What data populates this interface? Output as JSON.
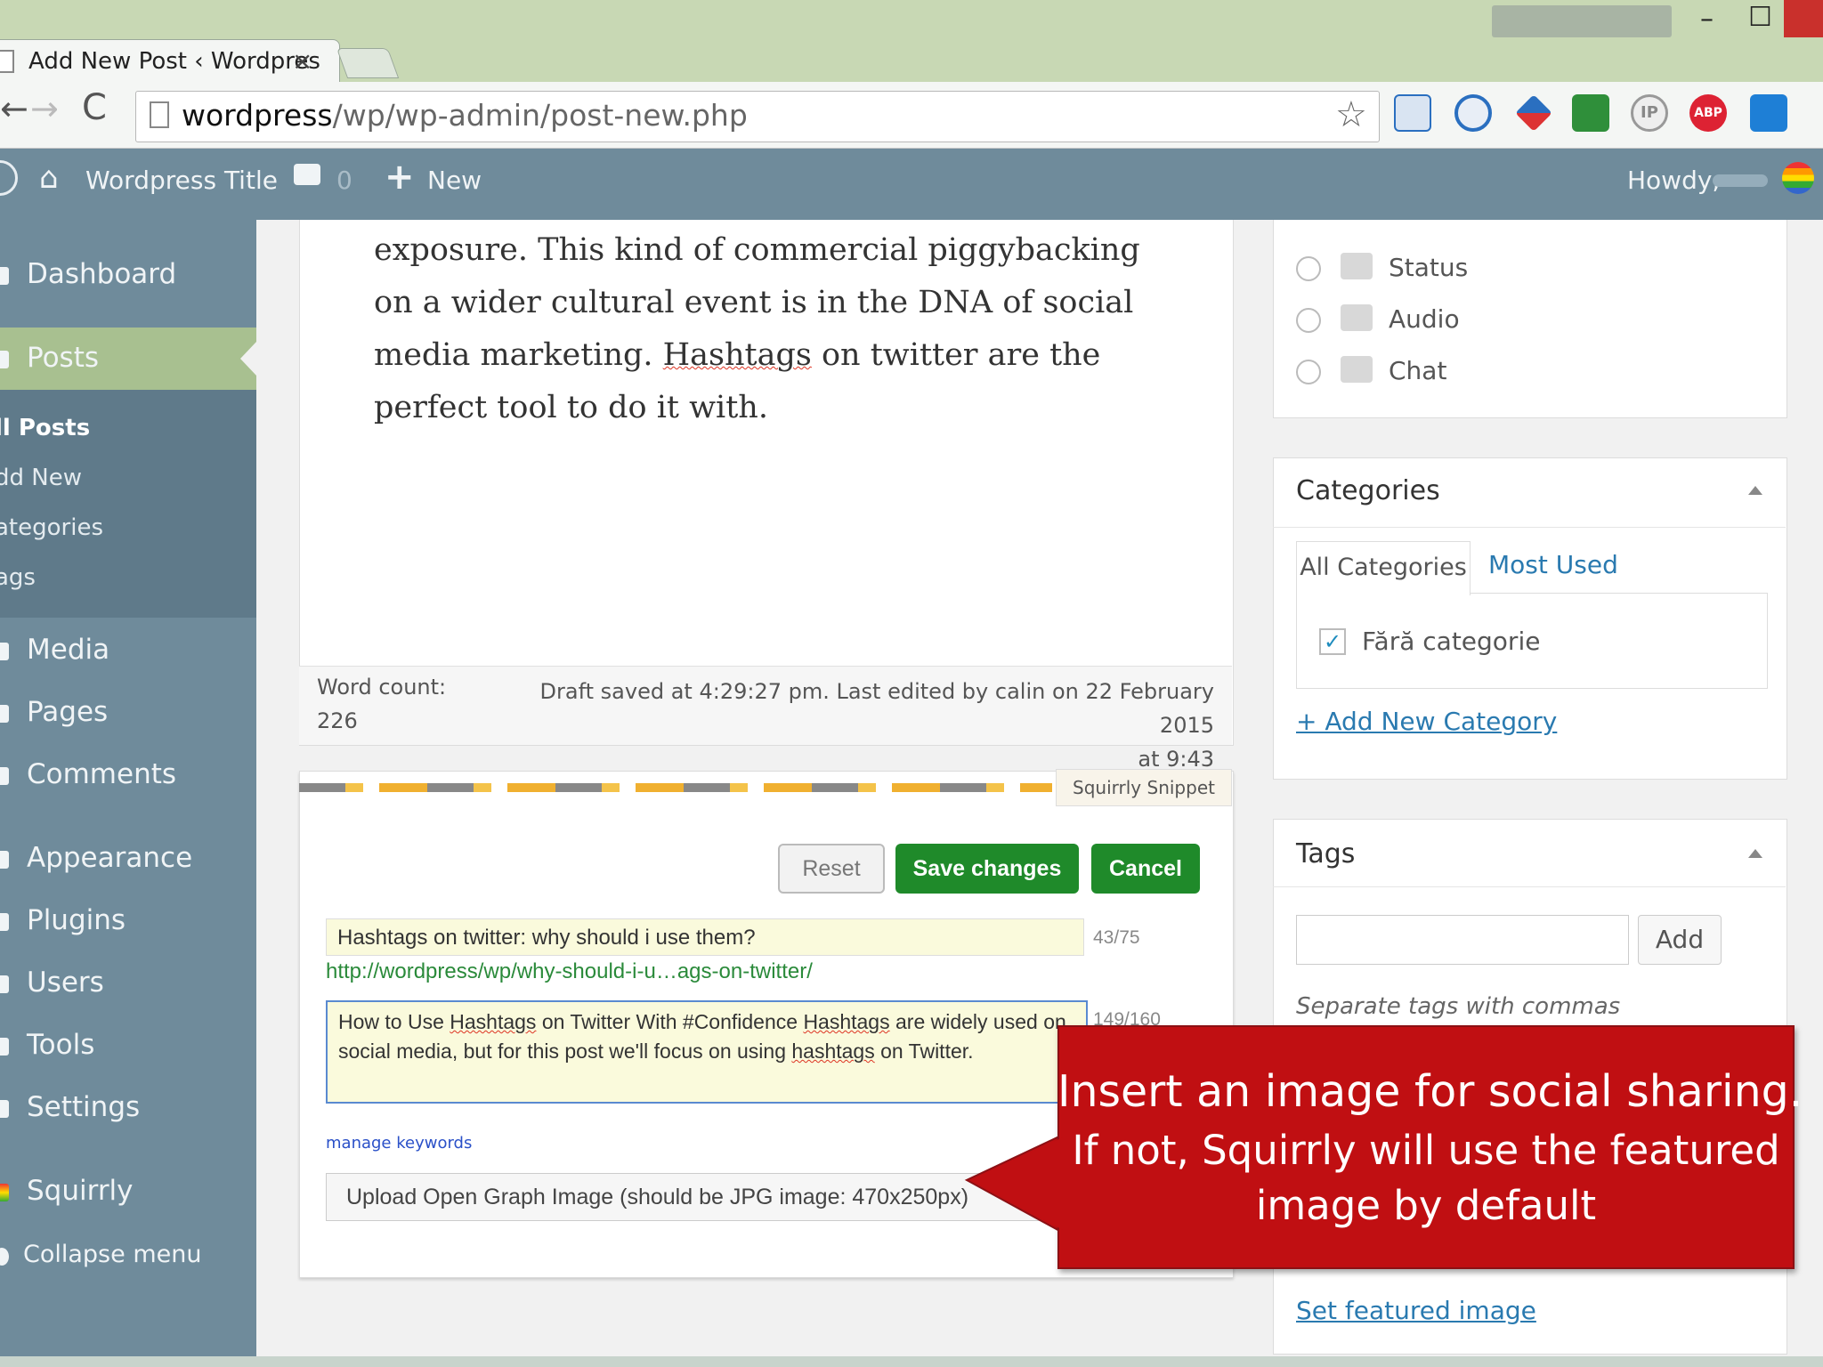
{
  "browser": {
    "tab_title": "Add New Post ‹ Wordpres",
    "tab_close": "×",
    "url_host": "wordpress",
    "url_path": "/wp/wp-admin/post-new.php",
    "window_controls": {
      "minimize": "–",
      "maximize": "☐"
    },
    "icons": [
      "back-arrow-icon",
      "forward-arrow-icon",
      "reload-icon",
      "page-icon",
      "star-icon",
      "extension-icons",
      "menu-icon"
    ],
    "nav": {
      "back": "←",
      "forward": "→",
      "reload": "C"
    }
  },
  "admin_bar": {
    "site_title": "Wordpress Title",
    "comment_count": "0",
    "new_label": "New",
    "howdy": "Howdy,"
  },
  "sidebar": {
    "items": [
      {
        "label": "Dashboard"
      },
      {
        "label": "Posts",
        "active": true
      },
      {
        "label": "Media"
      },
      {
        "label": "Pages"
      },
      {
        "label": "Comments"
      },
      {
        "label": "Appearance"
      },
      {
        "label": "Plugins"
      },
      {
        "label": "Users"
      },
      {
        "label": "Tools"
      },
      {
        "label": "Settings"
      },
      {
        "label": "Squirrly"
      },
      {
        "label": "Collapse menu"
      }
    ],
    "posts_submenu": [
      {
        "label": "ll Posts",
        "current": true
      },
      {
        "label": "dd New"
      },
      {
        "label": "ategories"
      },
      {
        "label": "ags"
      }
    ]
  },
  "editor": {
    "text_a": "exposure. This kind of commercial piggybacking on a wider cultural event is in the DNA of social media marketing. ",
    "text_b": "Hashtags",
    "text_c": " on twitter are the perfect tool to do it with.",
    "word_count_label": "Word count:",
    "word_count": "226",
    "draft_saved": "Draft saved at 4:29:27 pm. Last edited by calin on 22 February 2015",
    "draft_saved_time": "at 9:43"
  },
  "snippet": {
    "tab_label": "Squirrly Snippet",
    "reset_label": "Reset",
    "save_label": "Save changes",
    "cancel_label": "Cancel",
    "title_value": "Hashtags on twitter: why should i use them?",
    "title_count": "43/75",
    "url": "http://wordpress/wp/why-should-i-u…ags-on-twitter/",
    "desc_a": "How to Use ",
    "desc_b": "Hashtags",
    "desc_c": " on Twitter With #Confidence ",
    "desc_d": "Hashtags",
    "desc_e": " are widely used on social media, but for this post we'll focus on using ",
    "desc_f": "hashtags",
    "desc_g": " on Twitter.",
    "desc_count": "149/160",
    "manage_keywords": "manage keywords",
    "og_upload": "Upload Open Graph Image (should be JPG image: 470x250px)"
  },
  "format": {
    "options": [
      {
        "label": "Status",
        "icon": "status-bubble-icon"
      },
      {
        "label": "Audio",
        "icon": "music-note-icon"
      },
      {
        "label": "Chat",
        "icon": "chat-bubbles-icon"
      }
    ]
  },
  "categories": {
    "title": "Categories",
    "tab_all": "All Categories",
    "tab_most_used": "Most Used",
    "items": [
      {
        "label": "Fără categorie",
        "checked": true
      }
    ],
    "check_mark": "✓",
    "add_new": "+ Add New Category"
  },
  "tags": {
    "title": "Tags",
    "add_label": "Add",
    "hint": "Separate tags with commas"
  },
  "featured_image": {
    "set_label": "Set featured image"
  },
  "callout": {
    "line1": "Insert an image for social sharing.",
    "line2": "If not, Squirrly will use the featured image by default",
    "color": "#c00f12"
  },
  "colors": {
    "admin_bar": "#6f8b9b",
    "accent_green": "#1f8a2a",
    "active_menu": "#a8c090",
    "link": "#2a7ab0"
  }
}
